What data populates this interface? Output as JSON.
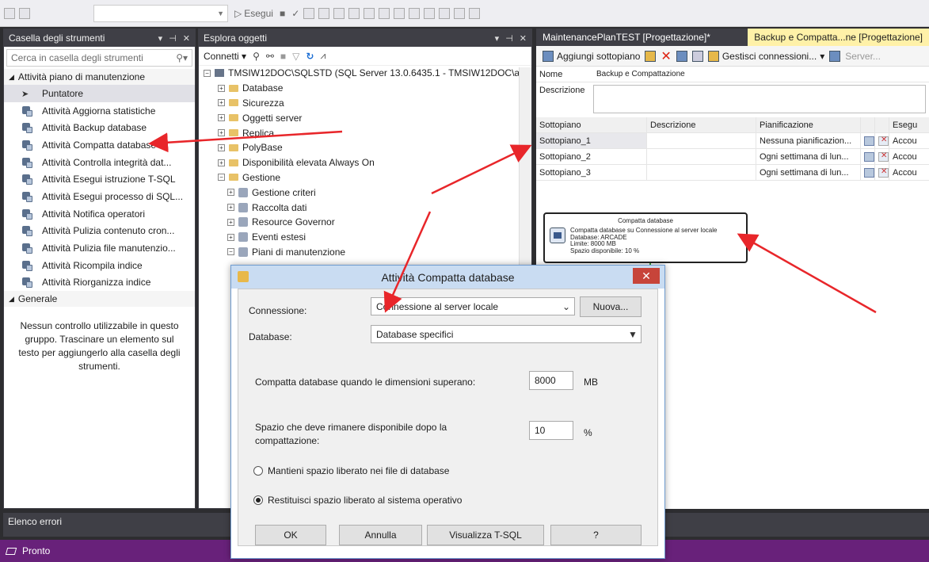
{
  "toolbar": {
    "execute_label": "Esegui"
  },
  "toolbox": {
    "title": "Casella degli strumenti",
    "search_placeholder": "Cerca in casella degli strumenti",
    "group_maintenance": "Attività piano di manutenzione",
    "items": [
      "Puntatore",
      "Attività Aggiorna statistiche",
      "Attività Backup database",
      "Attività Compatta database",
      "Attività Controlla integrità dat...",
      "Attività Esegui istruzione T-SQL",
      "Attività Esegui processo di SQL...",
      "Attività Notifica operatori",
      "Attività Pulizia contenuto cron...",
      "Attività Pulizia file manutenzio...",
      "Attività Ricompila indice",
      "Attività Riorganizza indice"
    ],
    "group_general": "Generale",
    "general_message": "Nessun controllo utilizzabile in questo gruppo. Trascinare un elemento sul testo per aggiungerlo alla casella degli strumenti."
  },
  "explorer": {
    "title": "Esplora oggetti",
    "connect_label": "Connetti",
    "server_node": "TMSIW12DOC\\SQLSTD (SQL Server 13.0.6435.1 - TMSIW12DOC\\a",
    "nodes": [
      {
        "label": "Database",
        "level": 1,
        "exp": "+"
      },
      {
        "label": "Sicurezza",
        "level": 1,
        "exp": "+"
      },
      {
        "label": "Oggetti server",
        "level": 1,
        "exp": "+"
      },
      {
        "label": "Replica",
        "level": 1,
        "exp": "+"
      },
      {
        "label": "PolyBase",
        "level": 1,
        "exp": "+"
      },
      {
        "label": "Disponibilità elevata Always On",
        "level": 1,
        "exp": "+"
      },
      {
        "label": "Gestione",
        "level": 1,
        "exp": "−"
      },
      {
        "label": "Gestione criteri",
        "level": 2,
        "exp": "+"
      },
      {
        "label": "Raccolta dati",
        "level": 2,
        "exp": "+"
      },
      {
        "label": "Resource Governor",
        "level": 2,
        "exp": "+"
      },
      {
        "label": "Eventi estesi",
        "level": 2,
        "exp": "+"
      },
      {
        "label": "Piani di manutenzione",
        "level": 2,
        "exp": "−"
      }
    ]
  },
  "designer": {
    "tab1": "MaintenancePlanTEST [Progettazione]*",
    "tab2": "Backup e Compatta...ne [Progettazione]",
    "add_subplan": "Aggiungi sottopiano",
    "manage_connections": "Gestisci connessioni...",
    "server_label": "Server...",
    "name_label": "Nome",
    "name_value": "Backup e Compattazione",
    "desc_label": "Descrizione",
    "columns": [
      "Sottopiano",
      "Descrizione",
      "Pianificazione",
      "",
      "",
      "Esegu"
    ],
    "rows": [
      {
        "name": "Sottopiano_1",
        "desc": "",
        "schedule": "Nessuna pianificazion...",
        "run": "Accou"
      },
      {
        "name": "Sottopiano_2",
        "desc": "",
        "schedule": "Ogni settimana di lun...",
        "run": "Accou"
      },
      {
        "name": "Sottopiano_3",
        "desc": "",
        "schedule": "Ogni settimana di lun...",
        "run": "Accou"
      }
    ],
    "task": {
      "title": "Compatta database",
      "lines": [
        "Compatta database su Connessione al server locale",
        "Database: ARCADE",
        "Limite: 8000 MB",
        "Spazio disponibile: 10 %"
      ]
    }
  },
  "errorlist": {
    "title": "Elenco errori"
  },
  "status": {
    "text": "Pronto"
  },
  "dialog": {
    "title": "Attività Compatta database",
    "conn_label": "Connessione:",
    "conn_value": "Connessione al server locale",
    "new_button": "Nuova...",
    "db_label": "Database:",
    "db_value": "Database specifici",
    "shrink_label": "Compatta database quando le dimensioni superano:",
    "shrink_value": "8000",
    "shrink_unit": "MB",
    "free_label": "Spazio che deve rimanere disponibile dopo la compattazione:",
    "free_value": "10",
    "free_unit": "%",
    "radio1": "Mantieni spazio liberato nei file di database",
    "radio2": "Restituisci spazio liberato al sistema operativo",
    "selected_radio": 2,
    "ok": "OK",
    "cancel": "Annulla",
    "tsql": "Visualizza T-SQL",
    "help": "?"
  },
  "colors": {
    "accent_status": "#68217a",
    "annotation_arrow": "#e8262a",
    "tab_active": "#fff1a8"
  }
}
